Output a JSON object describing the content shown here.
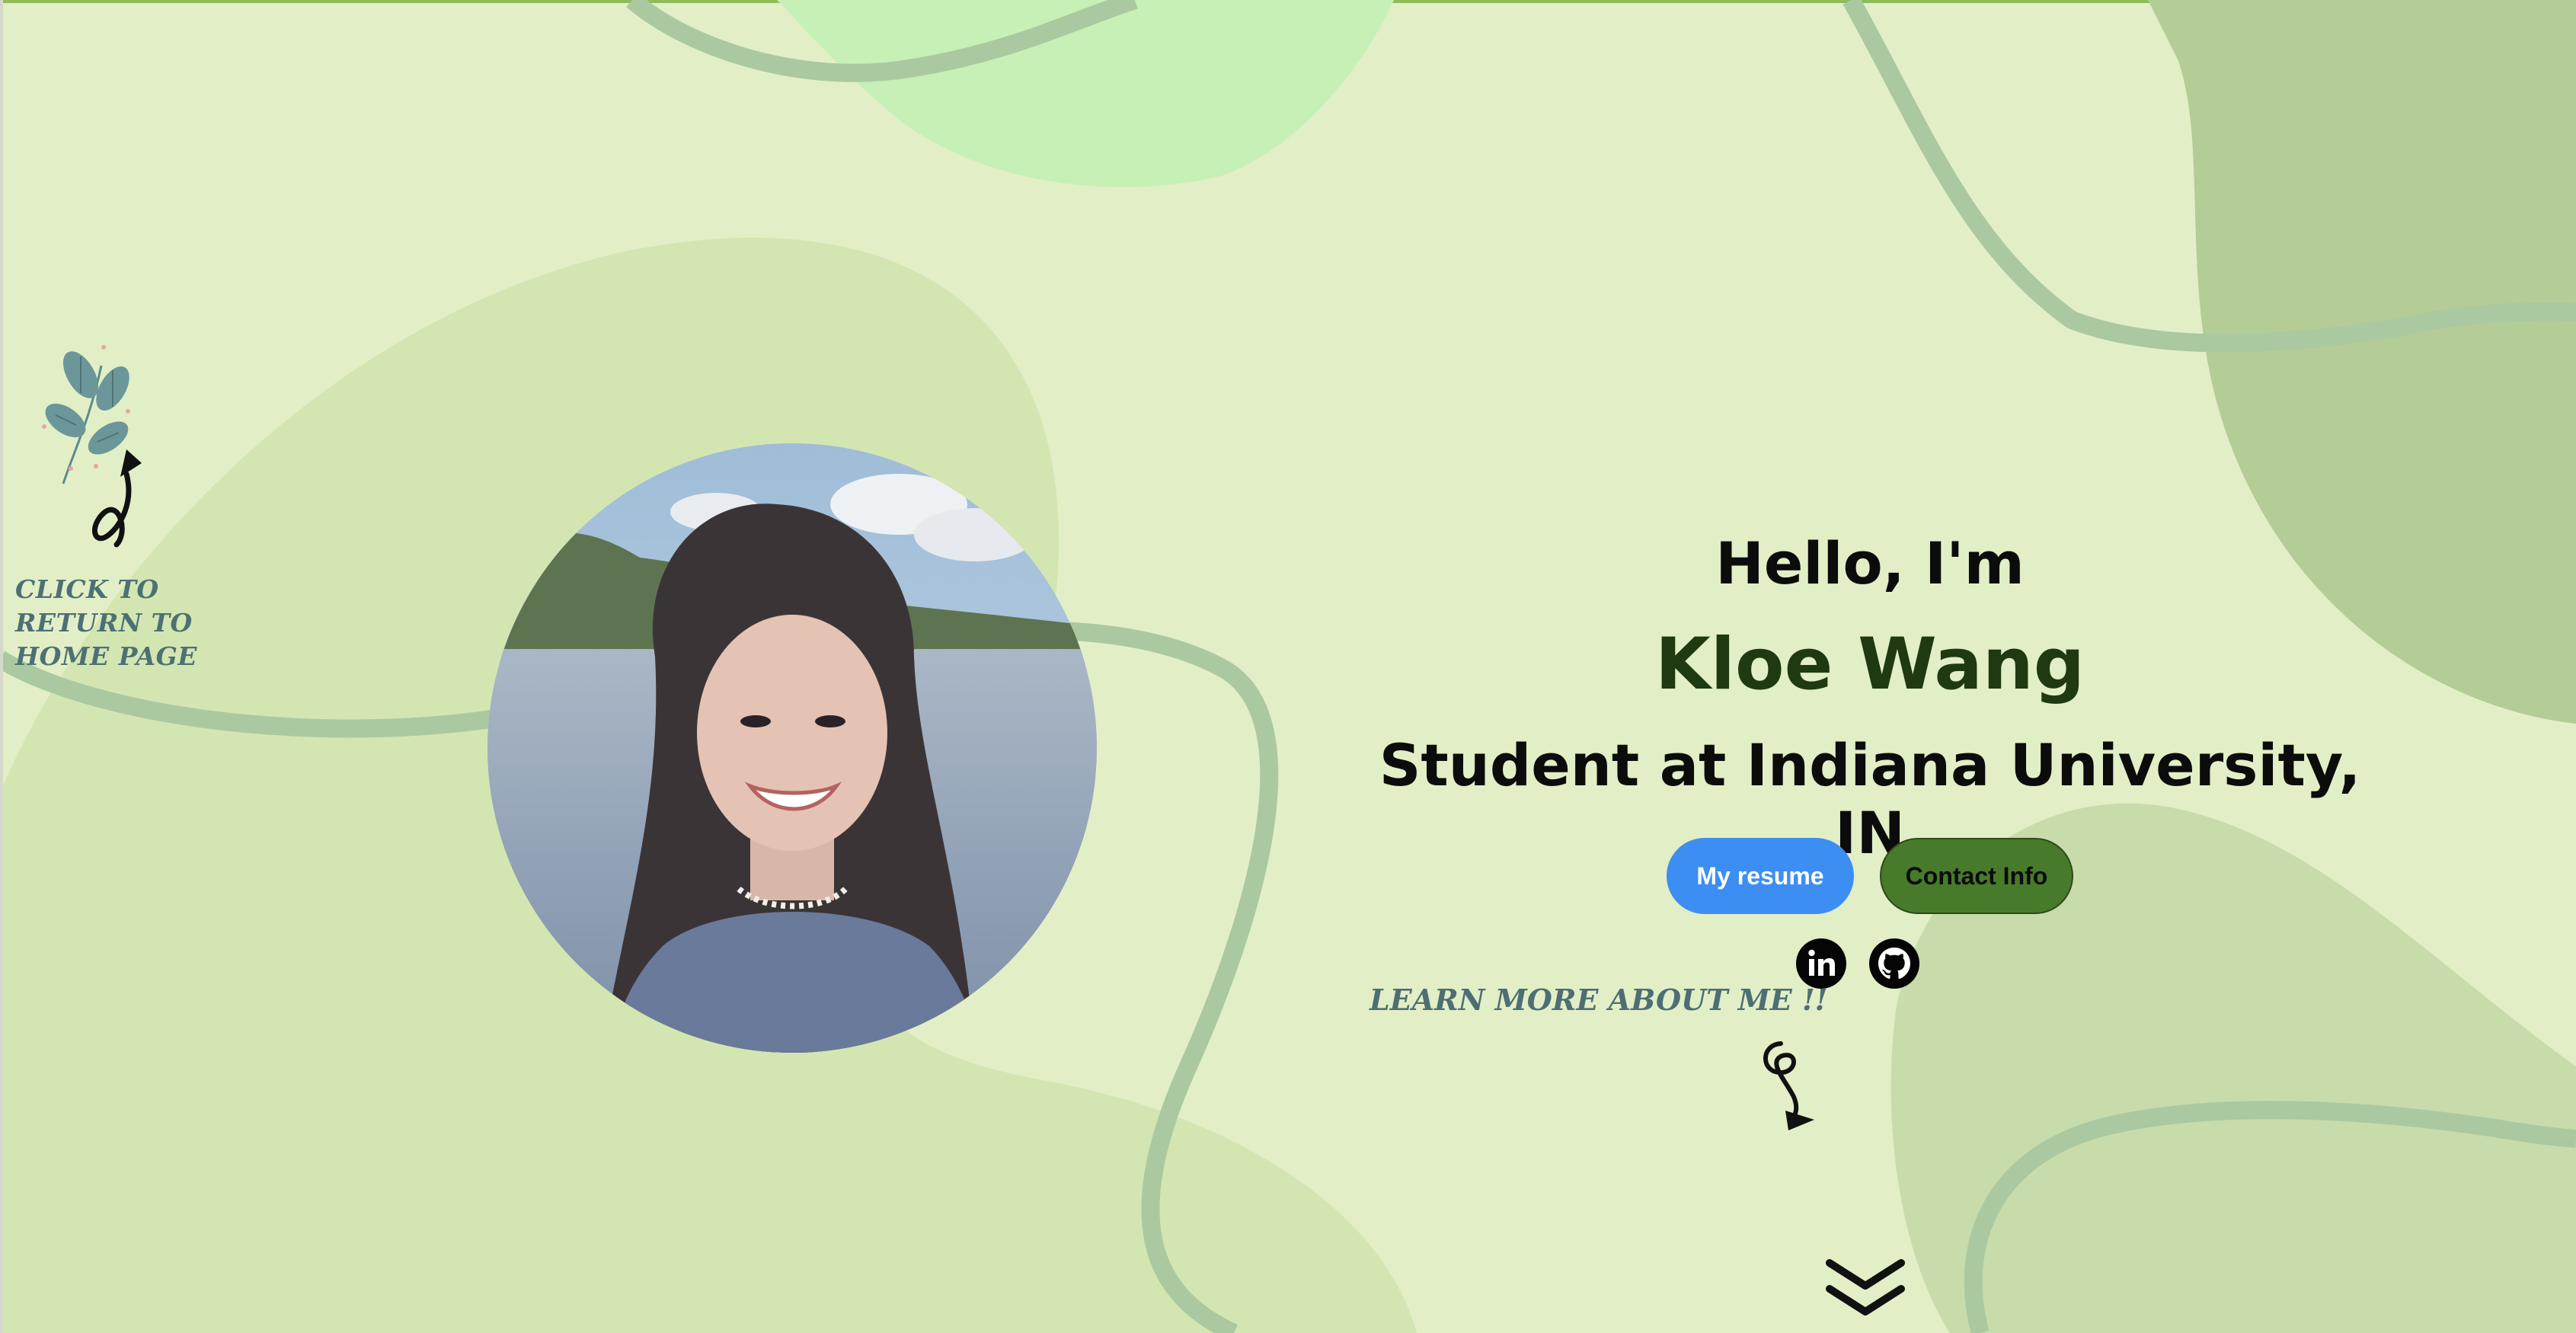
{
  "sidebar": {
    "home_link_text": "CLICK TO RETURN TO HOME PAGE",
    "home_link_icon": "leaf-sprig-icon"
  },
  "hero": {
    "greeting": "Hello, I'm",
    "name": "Kloe Wang",
    "subtitle": "Student at Indiana University, IN",
    "photo_alt": "Kloe Wang"
  },
  "actions": {
    "resume_label": "My resume",
    "contact_label": "Contact Info"
  },
  "social": {
    "linkedin_icon": "linkedin-icon",
    "github_icon": "github-icon"
  },
  "learn_more": {
    "text": "LEARN MORE ABOUT ME !!"
  },
  "scroll": {
    "icon": "double-chevron-down-icon"
  },
  "colors": {
    "background": "#e2efc6",
    "name_green": "#1f3a10",
    "resume_button": "#3d8ef2",
    "contact_button": "#477b2b",
    "accent_teal": "#4d7074"
  }
}
